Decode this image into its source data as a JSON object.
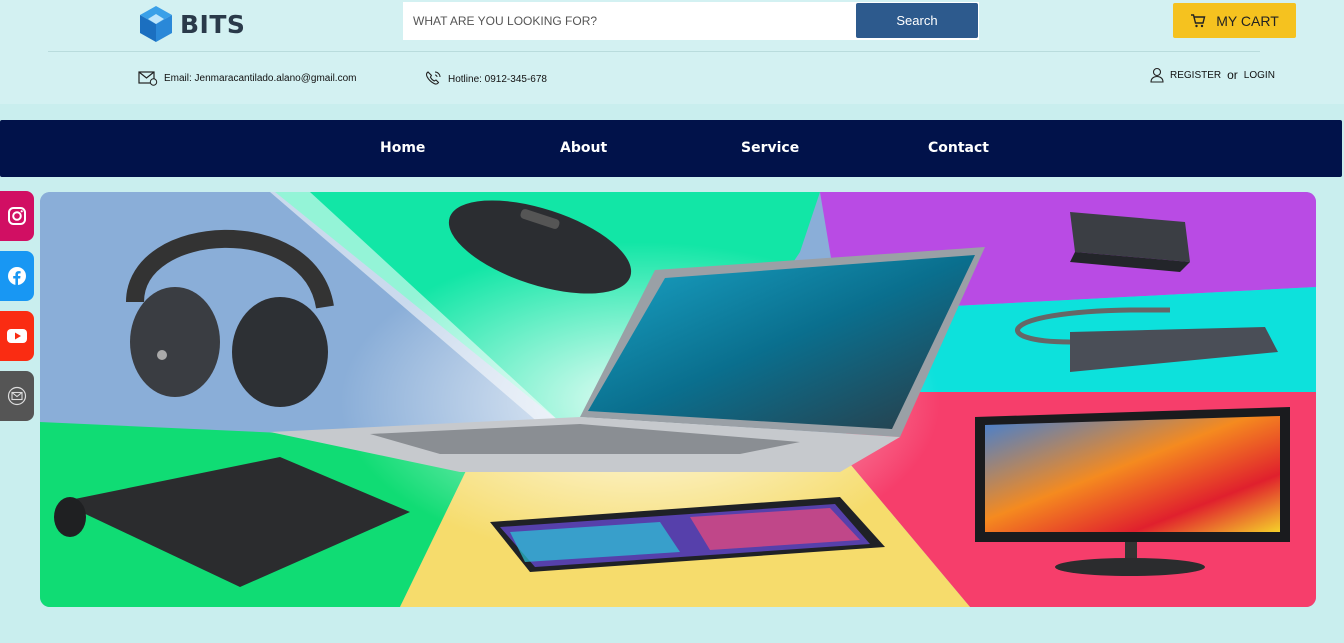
{
  "brand": {
    "name": "BITS"
  },
  "search": {
    "placeholder": "WHAT ARE YOU LOOKING FOR?",
    "button_label": "Search"
  },
  "cart": {
    "label": "MY CART",
    "icon": "cart-icon"
  },
  "contact": {
    "email_text": "Email: Jenmaracantilado.alano@gmail.com",
    "hotline_text": "Hotline: 0912-345-678"
  },
  "auth": {
    "register": "REGISTER",
    "or": "or",
    "login": "LOGIN"
  },
  "nav": {
    "items": [
      {
        "label": "Home"
      },
      {
        "label": "About"
      },
      {
        "label": "Service"
      },
      {
        "label": "Contact"
      }
    ]
  },
  "social": [
    {
      "name": "instagram-icon",
      "color": "#d10f63"
    },
    {
      "name": "facebook-icon",
      "color": "#1897f3"
    },
    {
      "name": "youtube-icon",
      "color": "#fa2c12"
    },
    {
      "name": "mail-icon",
      "color": "#555555"
    }
  ],
  "colors": {
    "nav_bg": "#01124a",
    "search_button": "#2d5a8d",
    "cart_button": "#f5c21f",
    "page_bg": "#c9eeee"
  }
}
